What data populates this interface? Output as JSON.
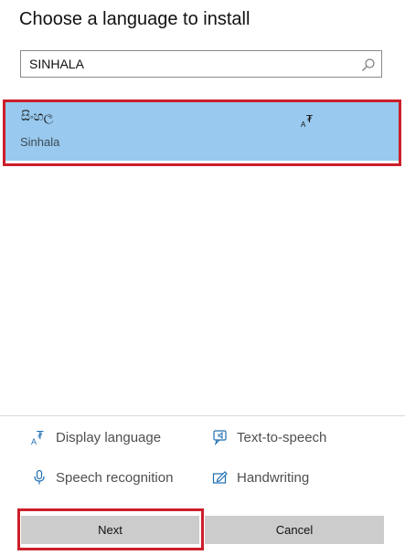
{
  "dialog": {
    "title": "Choose a language to install"
  },
  "search": {
    "value": "SINHALA",
    "icon": "search-icon"
  },
  "results": [
    {
      "native_name": "සිංහල",
      "english_name": "Sinhala",
      "selected": true,
      "feature_icon": "display-language-icon"
    }
  ],
  "features": {
    "display_language": "Display language",
    "text_to_speech": "Text-to-speech",
    "speech_recognition": "Speech recognition",
    "handwriting": "Handwriting"
  },
  "buttons": {
    "next": "Next",
    "cancel": "Cancel"
  },
  "colors": {
    "selection": "#99c9ee",
    "highlight_border": "#cc1f2a",
    "icon_accent": "#1f6fb2",
    "button_bg": "#cccccc"
  }
}
